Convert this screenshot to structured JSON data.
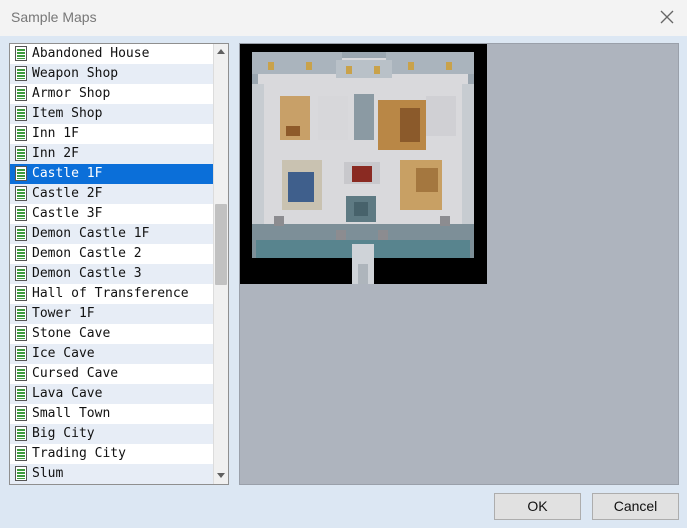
{
  "window": {
    "title": "Sample Maps"
  },
  "map_list": {
    "selected_index": 6,
    "items": [
      {
        "label": "Abandoned House"
      },
      {
        "label": "Weapon Shop"
      },
      {
        "label": "Armor Shop"
      },
      {
        "label": "Item Shop"
      },
      {
        "label": "Inn 1F"
      },
      {
        "label": "Inn 2F"
      },
      {
        "label": "Castle 1F"
      },
      {
        "label": "Castle 2F"
      },
      {
        "label": "Castle 3F"
      },
      {
        "label": "Demon Castle 1F"
      },
      {
        "label": "Demon Castle 2"
      },
      {
        "label": "Demon Castle 3"
      },
      {
        "label": "Hall of Transference"
      },
      {
        "label": "Tower 1F"
      },
      {
        "label": "Stone Cave"
      },
      {
        "label": "Ice Cave"
      },
      {
        "label": "Cursed Cave"
      },
      {
        "label": "Lava Cave"
      },
      {
        "label": "Small Town"
      },
      {
        "label": "Big City"
      },
      {
        "label": "Trading City"
      },
      {
        "label": "Slum"
      }
    ],
    "scroll_position": 0.36
  },
  "buttons": {
    "ok_label": "OK",
    "cancel_label": "Cancel"
  },
  "colors": {
    "selection": "#0b6fd9",
    "preview_bg": "#aeb4be",
    "dialog_bg": "#dce7f3"
  }
}
